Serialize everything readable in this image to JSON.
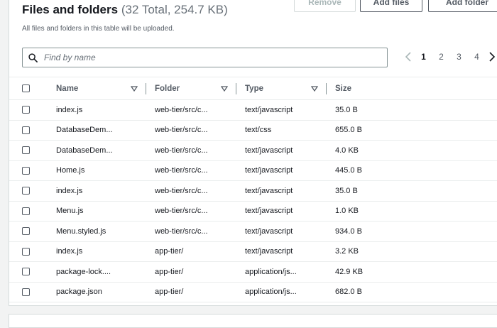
{
  "header": {
    "title": "Files and folders",
    "count": "(32 Total, 254.7 KB)",
    "subtitle": "All files and folders in this table will be uploaded."
  },
  "buttons": {
    "remove": "Remove",
    "add_files": "Add files",
    "add_folder": "Add folder"
  },
  "search": {
    "placeholder": "Find by name",
    "value": ""
  },
  "pagination": {
    "pages": [
      "1",
      "2",
      "3",
      "4"
    ],
    "current": "1"
  },
  "table": {
    "columns": [
      "Name",
      "Folder",
      "Type",
      "Size"
    ],
    "rows": [
      {
        "name": "index.js",
        "folder": "web-tier/src/c...",
        "type": "text/javascript",
        "size": "35.0 B"
      },
      {
        "name": "DatabaseDem...",
        "folder": "web-tier/src/c...",
        "type": "text/css",
        "size": "655.0 B"
      },
      {
        "name": "DatabaseDem...",
        "folder": "web-tier/src/c...",
        "type": "text/javascript",
        "size": "4.0 KB"
      },
      {
        "name": "Home.js",
        "folder": "web-tier/src/c...",
        "type": "text/javascript",
        "size": "445.0 B"
      },
      {
        "name": "index.js",
        "folder": "web-tier/src/c...",
        "type": "text/javascript",
        "size": "35.0 B"
      },
      {
        "name": "Menu.js",
        "folder": "web-tier/src/c...",
        "type": "text/javascript",
        "size": "1.0 KB"
      },
      {
        "name": "Menu.styled.js",
        "folder": "web-tier/src/c...",
        "type": "text/javascript",
        "size": "934.0 B"
      },
      {
        "name": "index.js",
        "folder": "app-tier/",
        "type": "text/javascript",
        "size": "3.2 KB"
      },
      {
        "name": "package-lock....",
        "folder": "app-tier/",
        "type": "application/js...",
        "size": "42.9 KB"
      },
      {
        "name": "package.json",
        "folder": "app-tier/",
        "type": "application/js...",
        "size": "682.0 B"
      }
    ]
  },
  "colors": {
    "text": "#16191f",
    "muted": "#545b64",
    "border": "#d5dbdb",
    "background": "#f2f3f3"
  }
}
